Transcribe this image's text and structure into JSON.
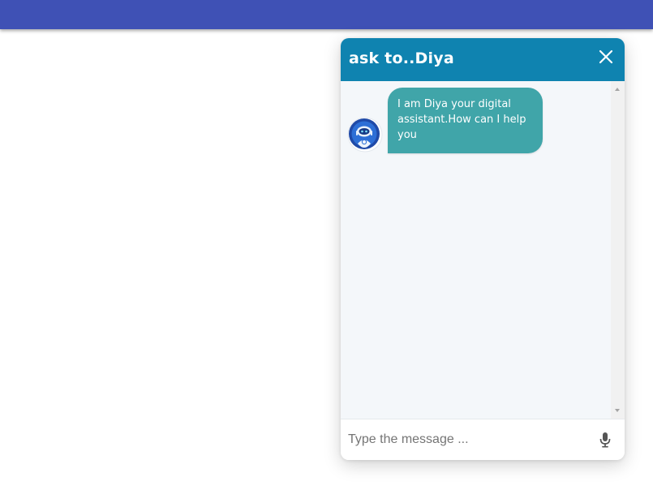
{
  "colors": {
    "topbar": "#3f51b5",
    "chat_header": "#0f83b0",
    "bot_bubble": "#40a5a9",
    "chat_body": "#f4f7fa"
  },
  "chat": {
    "title": "ask to..Diya",
    "close_icon": "close-icon",
    "messages": [
      {
        "sender": "bot",
        "avatar_icon": "robot-avatar-icon",
        "text": "I am Diya your digital assistant.How can I help you"
      }
    ],
    "input": {
      "value": "",
      "placeholder": "Type the message ..."
    },
    "mic_icon": "microphone-icon"
  }
}
